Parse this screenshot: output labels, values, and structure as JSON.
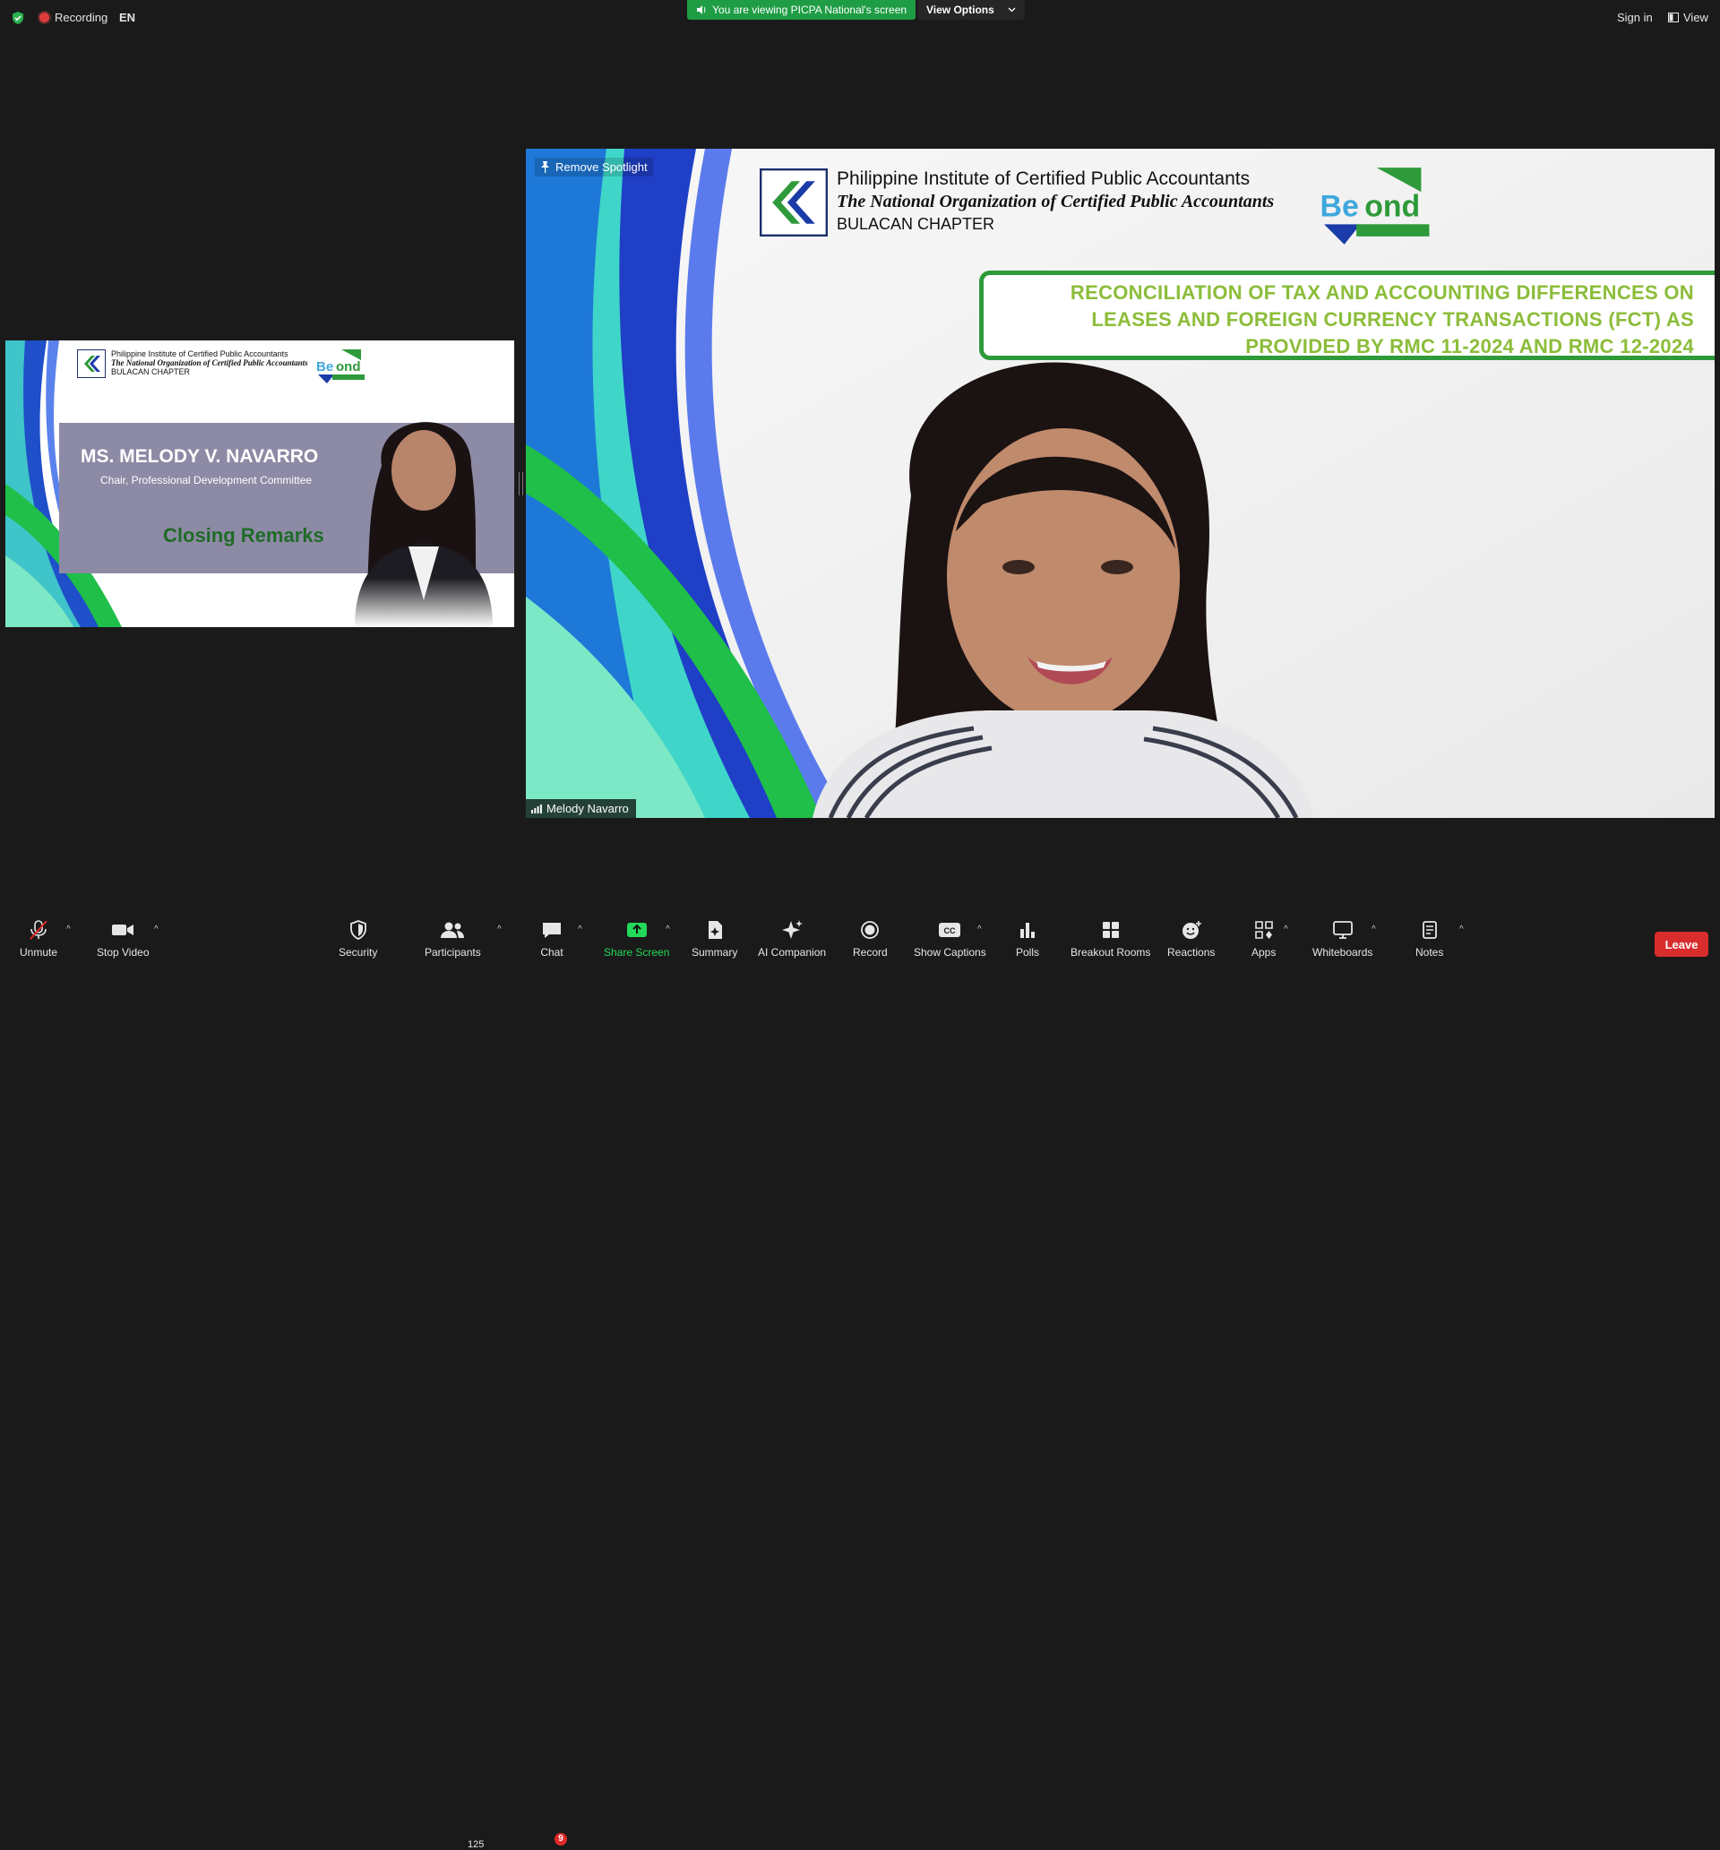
{
  "topbar": {
    "recording_label": "Recording",
    "language": "EN",
    "viewing_notice": "You are viewing PICPA National's screen",
    "view_options_label": "View Options",
    "sign_in_label": "Sign in",
    "view_label": "View"
  },
  "small_slide": {
    "org_line1": "Philippine Institute of Certified Public Accountants",
    "org_line2": "The National Organization of Certified Public Accountants",
    "org_line3": "BULACAN CHAPTER",
    "speaker_name": "MS. MELODY V. NAVARRO",
    "speaker_role": "Chair, Professional Development Committee",
    "segment": "Closing Remarks"
  },
  "main_tile": {
    "remove_spotlight_label": "Remove Spotlight",
    "participant_name": "Melody Navarro",
    "org_line1": "Philippine Institute of Certified Public Accountants",
    "org_line2": "The National Organization of Certified Public Accountants",
    "org_line3": "BULACAN CHAPTER",
    "title_line1": "RECONCILIATION OF TAX AND ACCOUNTING DIFFERENCES ON",
    "title_line2": "LEASES AND FOREIGN CURRENCY TRANSACTIONS (FCT) AS",
    "title_line3": "PROVIDED BY RMC 11-2024 AND RMC 12-2024"
  },
  "toolbar": {
    "unmute": "Unmute",
    "stop_video": "Stop Video",
    "security": "Security",
    "participants": "Participants",
    "participants_count": "125",
    "chat": "Chat",
    "chat_badge": "9",
    "share_screen": "Share Screen",
    "summary": "Summary",
    "ai_companion": "AI Companion",
    "record": "Record",
    "show_captions": "Show Captions",
    "polls": "Polls",
    "breakout_rooms": "Breakout Rooms",
    "reactions": "Reactions",
    "apps": "Apps",
    "whiteboards": "Whiteboards",
    "notes": "Notes",
    "leave": "Leave"
  },
  "colors": {
    "share_green": "#23d959",
    "leave_red": "#d92d2d",
    "viewing_green": "#1f9d45"
  }
}
